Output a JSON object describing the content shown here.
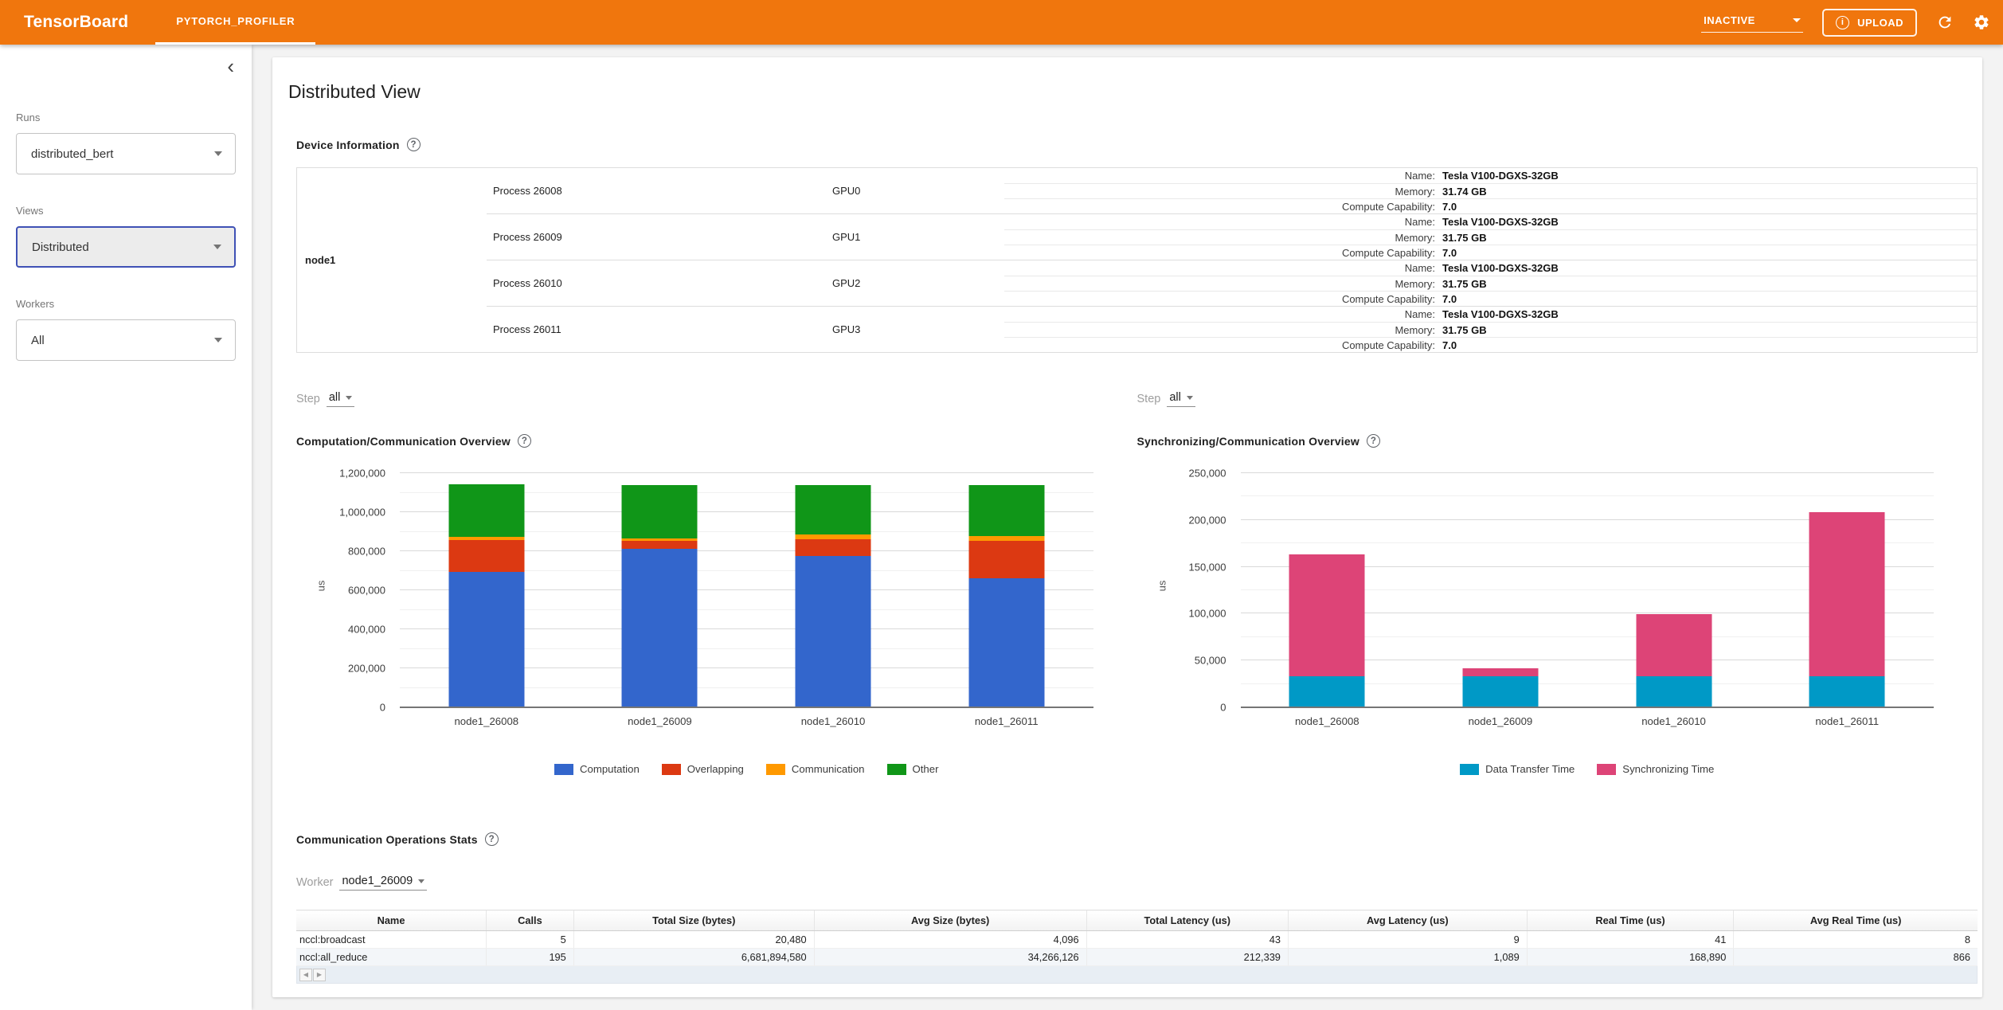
{
  "appbar": {
    "logo": "TensorBoard",
    "tab": "PYTORCH_PROFILER",
    "status": "INACTIVE",
    "upload_label": "UPLOAD"
  },
  "sidebar": {
    "runs_label": "Runs",
    "runs_value": "distributed_bert",
    "views_label": "Views",
    "views_value": "Distributed",
    "workers_label": "Workers",
    "workers_value": "All"
  },
  "main": {
    "title": "Distributed View",
    "device_info_title": "Device Information",
    "step_label": "Step",
    "step_value": "all",
    "comm_ops_title": "Communication Operations Stats",
    "worker_label": "Worker",
    "worker_value": "node1_26009"
  },
  "device_table": {
    "node": "node1",
    "rows": [
      {
        "process": "Process 26008",
        "gpu": "GPU0",
        "kv": [
          [
            "Name:",
            "Tesla V100-DGXS-32GB"
          ],
          [
            "Memory:",
            "31.74 GB"
          ],
          [
            "Compute Capability:",
            "7.0"
          ]
        ]
      },
      {
        "process": "Process 26009",
        "gpu": "GPU1",
        "kv": [
          [
            "Name:",
            "Tesla V100-DGXS-32GB"
          ],
          [
            "Memory:",
            "31.75 GB"
          ],
          [
            "Compute Capability:",
            "7.0"
          ]
        ]
      },
      {
        "process": "Process 26010",
        "gpu": "GPU2",
        "kv": [
          [
            "Name:",
            "Tesla V100-DGXS-32GB"
          ],
          [
            "Memory:",
            "31.75 GB"
          ],
          [
            "Compute Capability:",
            "7.0"
          ]
        ]
      },
      {
        "process": "Process 26011",
        "gpu": "GPU3",
        "kv": [
          [
            "Name:",
            "Tesla V100-DGXS-32GB"
          ],
          [
            "Memory:",
            "31.75 GB"
          ],
          [
            "Compute Capability:",
            "7.0"
          ]
        ]
      }
    ]
  },
  "chart_data": [
    {
      "type": "bar",
      "stacked": true,
      "title": "Computation/Communication Overview",
      "ylabel": "us",
      "categories": [
        "node1_26008",
        "node1_26009",
        "node1_26010",
        "node1_26011"
      ],
      "series": [
        {
          "name": "Computation",
          "color": "#3366cc",
          "values": [
            696000,
            814000,
            774000,
            663000
          ]
        },
        {
          "name": "Overlapping",
          "color": "#dc3912",
          "values": [
            160000,
            39000,
            86000,
            190000
          ]
        },
        {
          "name": "Communication",
          "color": "#ff9900",
          "values": [
            17000,
            14000,
            24000,
            26000
          ]
        },
        {
          "name": "Other",
          "color": "#109618",
          "values": [
            268000,
            274000,
            256000,
            259000
          ]
        }
      ],
      "ylim": [
        0,
        1200000
      ],
      "ytick_step": 200000,
      "yticks": [
        "0",
        "200,000",
        "400,000",
        "600,000",
        "800,000",
        "1,000,000",
        "1,200,000"
      ],
      "grid": true,
      "legend_position": "bottom"
    },
    {
      "type": "bar",
      "stacked": true,
      "title": "Synchronizing/Communication Overview",
      "ylabel": "us",
      "categories": [
        "node1_26008",
        "node1_26009",
        "node1_26010",
        "node1_26011"
      ],
      "series": [
        {
          "name": "Data Transfer Time",
          "color": "#0099c6",
          "values": [
            33500,
            33500,
            33500,
            33500
          ]
        },
        {
          "name": "Synchronizing Time",
          "color": "#dd4477",
          "values": [
            129500,
            8500,
            66000,
            174500
          ]
        }
      ],
      "ylim": [
        0,
        250000
      ],
      "ytick_step": 50000,
      "yticks": [
        "0",
        "50,000",
        "100,000",
        "150,000",
        "200,000",
        "250,000"
      ],
      "grid": true,
      "legend_position": "bottom"
    }
  ],
  "stats_table": {
    "headers": [
      "Name",
      "Calls",
      "Total Size (bytes)",
      "Avg Size (bytes)",
      "Total Latency (us)",
      "Avg Latency (us)",
      "Real Time (us)",
      "Avg Real Time (us)"
    ],
    "rows": [
      [
        "nccl:broadcast",
        "5",
        "20,480",
        "4,096",
        "43",
        "9",
        "41",
        "8"
      ],
      [
        "nccl:all_reduce",
        "195",
        "6,681,894,580",
        "34,266,126",
        "212,339",
        "1,089",
        "168,890",
        "866"
      ]
    ]
  },
  "colors": {
    "appbar": "#f0760d",
    "focus_accent": "#3f51b5",
    "computation": "#3366cc",
    "overlapping": "#dc3912",
    "communication": "#ff9900",
    "other": "#109618",
    "data_transfer": "#0099c6",
    "synchronizing": "#dd4477"
  }
}
